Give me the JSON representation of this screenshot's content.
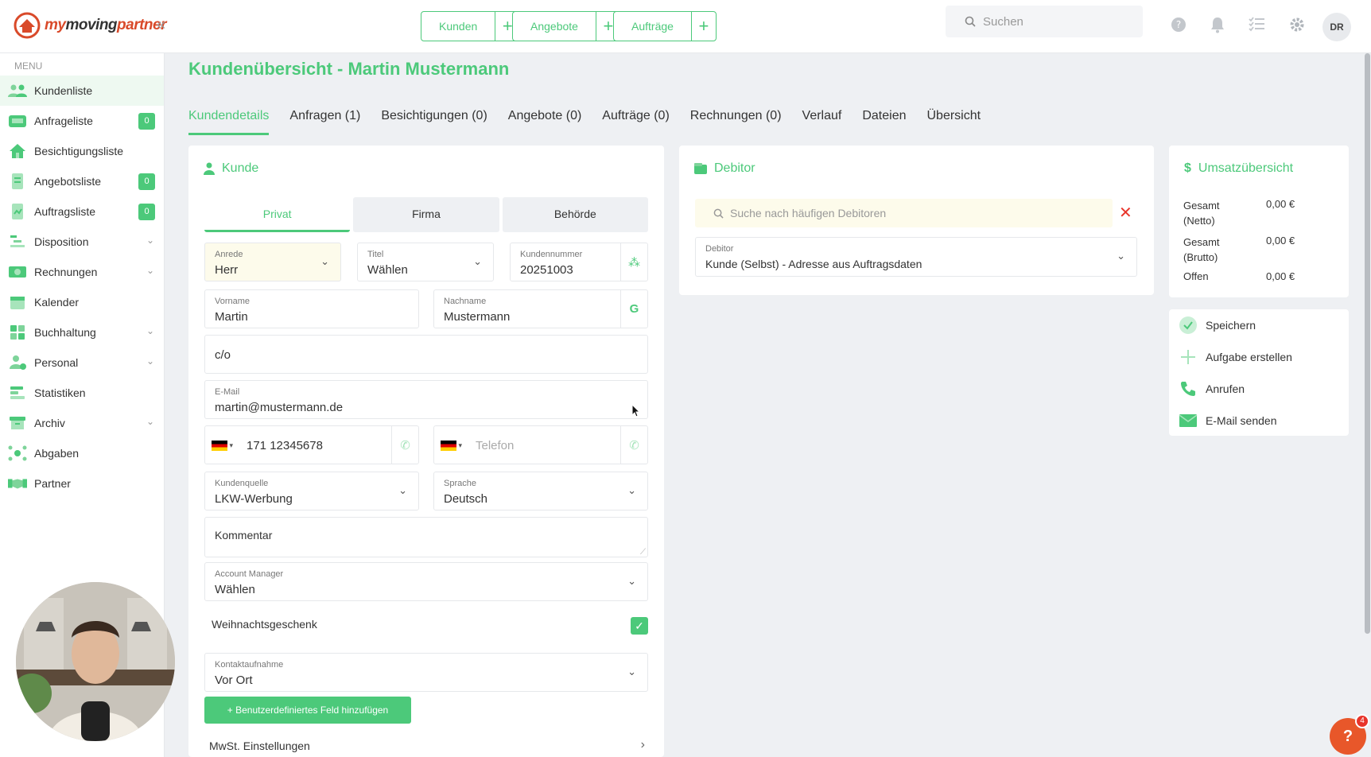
{
  "brand": {
    "name_part1": "my",
    "name_part2": "moving",
    "name_part3": "partner"
  },
  "topbar": {
    "quick_actions": [
      {
        "label": "Kunden"
      },
      {
        "label": "Angebote"
      },
      {
        "label": "Aufträge"
      }
    ],
    "search_placeholder": "Suchen",
    "avatar_initials": "DR"
  },
  "sidebar": {
    "menu_label": "MENU",
    "items": [
      {
        "label": "Kundenliste",
        "icon": "customers-icon"
      },
      {
        "label": "Anfrageliste",
        "icon": "inbox-icon",
        "badge": "0"
      },
      {
        "label": "Besichtigungsliste",
        "icon": "house-icon"
      },
      {
        "label": "Angebotsliste",
        "icon": "document-icon",
        "badge": "0"
      },
      {
        "label": "Auftragsliste",
        "icon": "order-icon",
        "badge": "0"
      },
      {
        "label": "Disposition",
        "icon": "disposition-icon"
      },
      {
        "label": "Rechnungen",
        "icon": "money-icon"
      },
      {
        "label": "Kalender",
        "icon": "calendar-icon"
      },
      {
        "label": "Buchhaltung",
        "icon": "accounting-icon"
      },
      {
        "label": "Personal",
        "icon": "staff-icon"
      },
      {
        "label": "Statistiken",
        "icon": "statistics-icon"
      },
      {
        "label": "Archiv",
        "icon": "archive-icon"
      },
      {
        "label": "Abgaben",
        "icon": "network-icon"
      },
      {
        "label": "Partner",
        "icon": "handshake-icon"
      }
    ]
  },
  "page": {
    "title": "Kundenübersicht - Martin Mustermann",
    "tabs": [
      "Kundendetails",
      "Anfragen (1)",
      "Besichtigungen (0)",
      "Angebote (0)",
      "Aufträge (0)",
      "Rechnungen (0)",
      "Verlauf",
      "Dateien",
      "Übersicht"
    ]
  },
  "kunde": {
    "title": "Kunde",
    "types": [
      "Privat",
      "Firma",
      "Behörde"
    ],
    "anrede_label": "Anrede",
    "anrede_value": "Herr",
    "titel_label": "Titel",
    "titel_value": "Wählen",
    "kundennummer_label": "Kundennummer",
    "kundennummer_value": "20251003",
    "vorname_label": "Vorname",
    "vorname_value": "Martin",
    "nachname_label": "Nachname",
    "nachname_value": "Mustermann",
    "co_placeholder": "c/o",
    "email_label": "E-Mail",
    "email_value": "martin@mustermann.de",
    "mobile_value": "171 12345678",
    "telefon_placeholder": "Telefon",
    "kundenquelle_label": "Kundenquelle",
    "kundenquelle_value": "LKW-Werbung",
    "sprache_label": "Sprache",
    "sprache_value": "Deutsch",
    "kommentar_placeholder": "Kommentar",
    "account_manager_label": "Account Manager",
    "account_manager_value": "Wählen",
    "weihnachtsgeschenk_label": "Weihnachtsgeschenk",
    "weihnachtsgeschenk_checked": true,
    "kontaktaufnahme_label": "Kontaktaufnahme",
    "kontaktaufnahme_value": "Vor Ort",
    "add_field_label": "Benutzerdefiniertes Feld hinzufügen",
    "mwst_label": "MwSt. Einstellungen"
  },
  "debitor": {
    "title": "Debitor",
    "search_placeholder": "Suche nach häufigen Debitoren",
    "field_label": "Debitor",
    "field_value": "Kunde (Selbst) - Adresse aus Auftragsdaten"
  },
  "umsatz": {
    "title": "Umsatzübersicht",
    "rows": [
      {
        "label_line1": "Gesamt",
        "label_line2": "(Netto)",
        "value": "0,00 €"
      },
      {
        "label_line1": "Gesamt",
        "label_line2": "(Brutto)",
        "value": "0,00 €"
      },
      {
        "label_line1": "Offen",
        "label_line2": "",
        "value": "0,00 €"
      }
    ]
  },
  "actions": {
    "save": "Speichern",
    "task": "Aufgabe erstellen",
    "call": "Anrufen",
    "mail": "E-Mail senden"
  },
  "help": {
    "badge": "4",
    "label": "?"
  },
  "colors": {
    "accent": "#4cc97a",
    "danger": "#e8342a",
    "background": "#eef0f3"
  }
}
